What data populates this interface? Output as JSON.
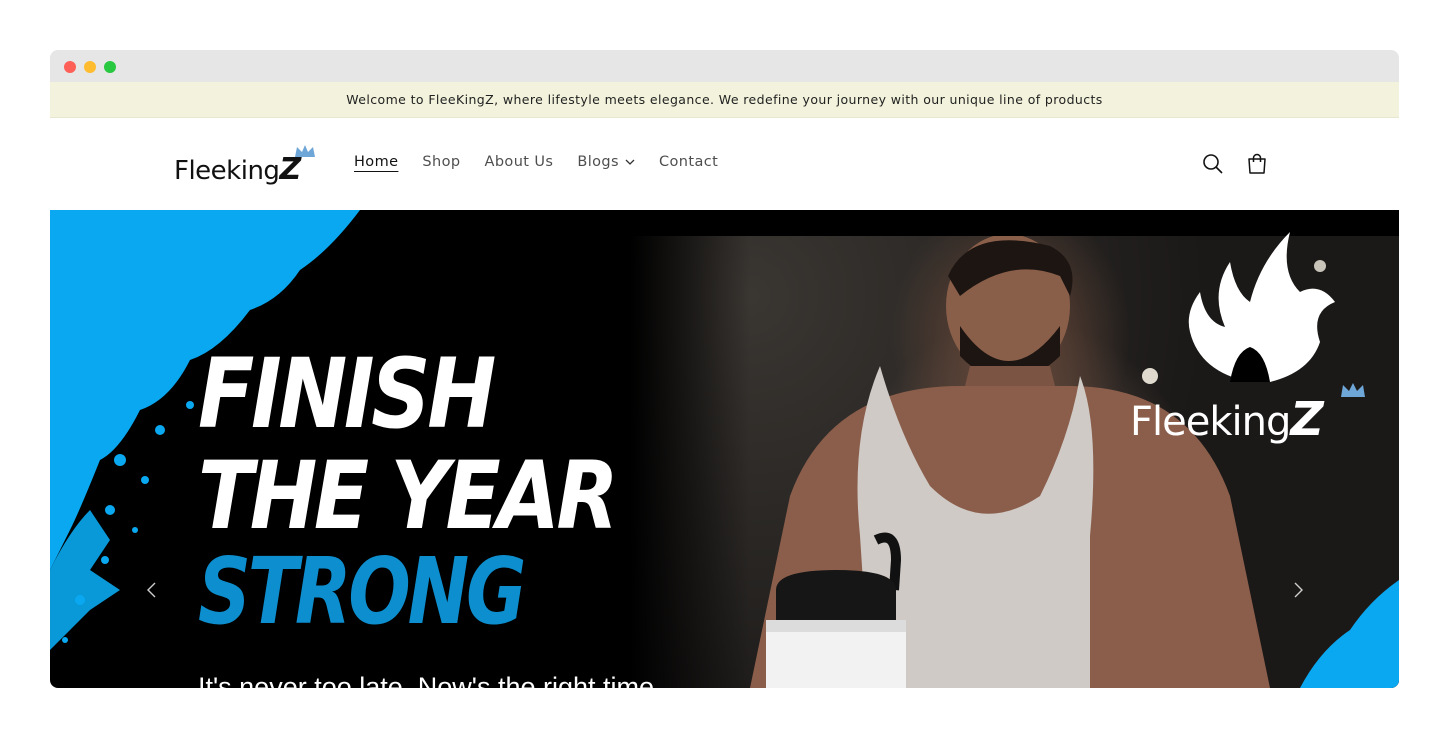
{
  "announcement": {
    "text": "Welcome to FleeKingZ, where lifestyle meets elegance. We redefine your journey with our unique line of products"
  },
  "header": {
    "logo_text": "Fleeking",
    "logo_z": "Z",
    "nav": [
      {
        "label": "Home",
        "active": true
      },
      {
        "label": "Shop",
        "active": false
      },
      {
        "label": "About Us",
        "active": false
      },
      {
        "label": "Blogs",
        "active": false,
        "dropdown": true
      },
      {
        "label": "Contact",
        "active": false
      }
    ],
    "icons": [
      "search-icon",
      "cart-icon"
    ]
  },
  "hero": {
    "headline_1": "FINISH",
    "headline_2": "THE YEAR",
    "headline_3": "STRONG",
    "subline": "It's never too late. Now's the right time",
    "brand_text": "Fleeking",
    "brand_z": "Z",
    "accent_color": "#0d8ecf",
    "brush_color": "#0aa8f0",
    "prev_icon": "chevron-left-icon",
    "next_icon": "chevron-right-icon"
  }
}
